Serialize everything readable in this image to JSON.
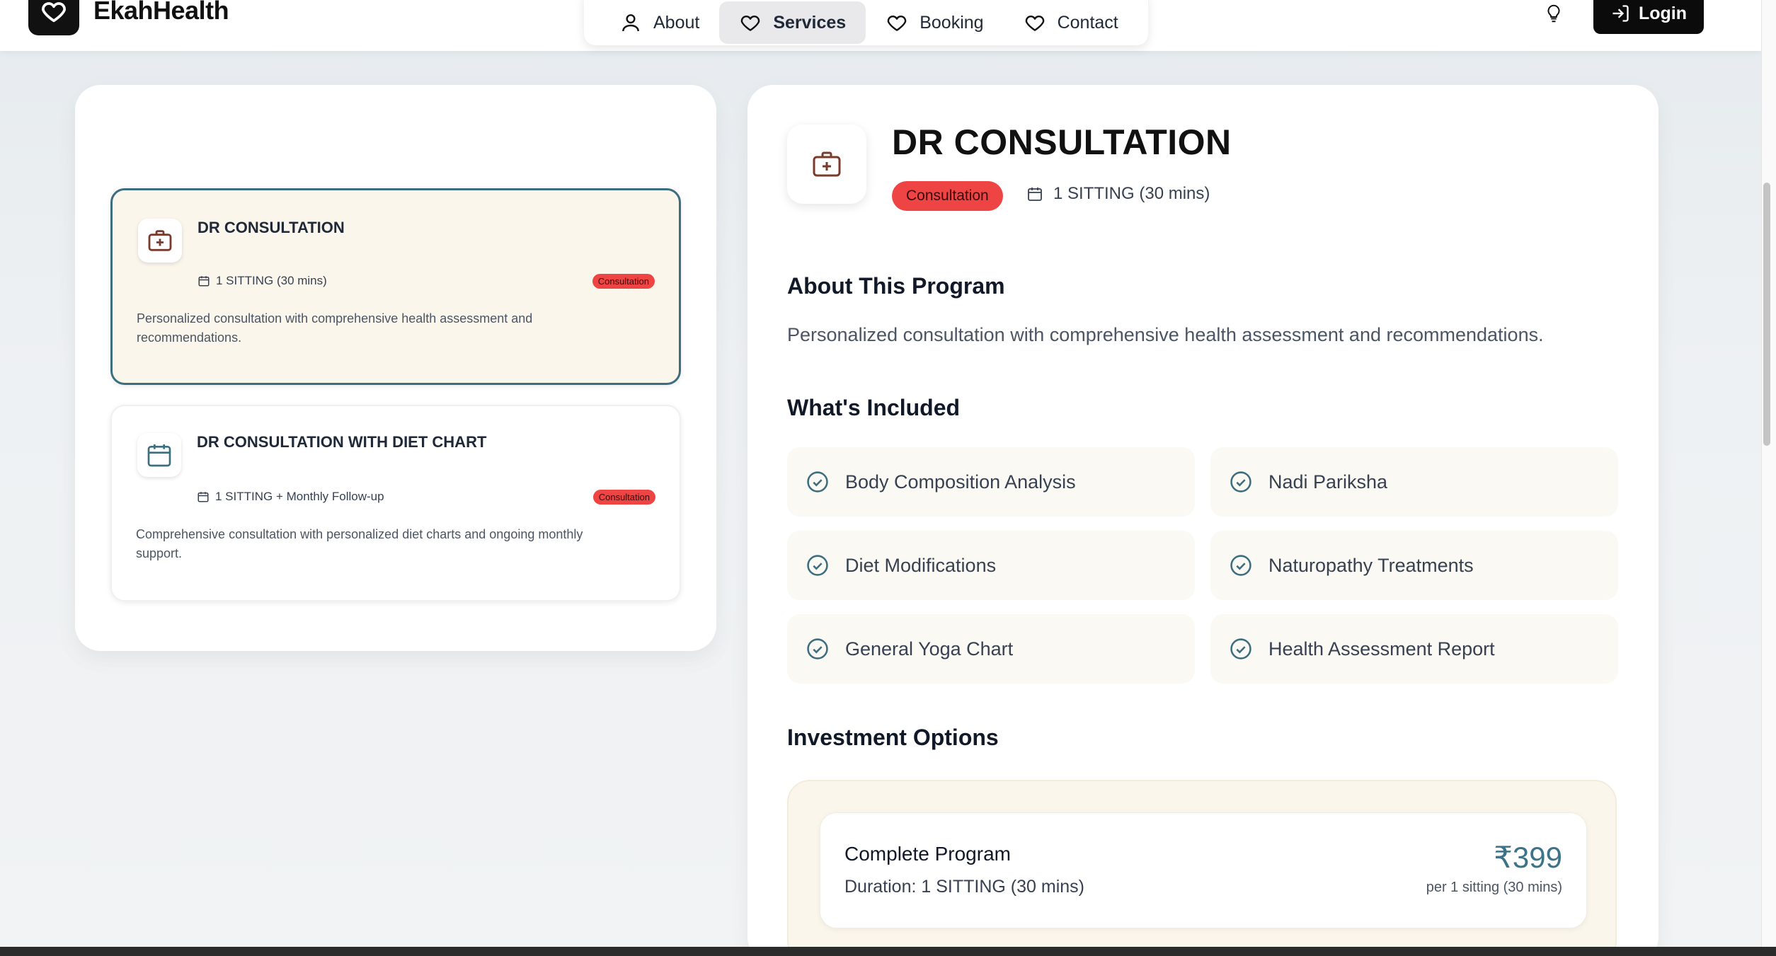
{
  "header": {
    "brand": "EkahHealth",
    "nav": [
      {
        "label": "About",
        "icon": "user-icon"
      },
      {
        "label": "Services",
        "icon": "heart-icon",
        "active": true
      },
      {
        "label": "Booking",
        "icon": "heart-icon"
      },
      {
        "label": "Contact",
        "icon": "heart-icon"
      }
    ],
    "login_label": "Login"
  },
  "services": [
    {
      "title": "DR CONSULTATION",
      "meta": "1 SITTING (30 mins)",
      "badge": "Consultation",
      "description": "Personalized consultation with comprehensive health assessment and recommendations.",
      "icon": "medical-kit-icon",
      "selected": true
    },
    {
      "title": "DR CONSULTATION WITH DIET CHART",
      "meta": "1 SITTING + Monthly Follow-up",
      "badge": "Consultation",
      "description": "Comprehensive consultation with personalized diet charts and ongoing monthly support.",
      "icon": "calendar-icon",
      "selected": false
    }
  ],
  "detail": {
    "title": "DR CONSULTATION",
    "badge": "Consultation",
    "meta": "1 SITTING (30 mins)",
    "about_heading": "About This Program",
    "about_text": "Personalized consultation with comprehensive health assessment and recommendations.",
    "included_heading": "What's Included",
    "included": [
      "Body Composition Analysis",
      "Nadi Pariksha",
      "Diet Modifications",
      "Naturopathy Treatments",
      "General Yoga Chart",
      "Health Assessment Report"
    ],
    "investment_heading": "Investment Options",
    "investment": {
      "name": "Complete Program",
      "duration": "Duration: 1 SITTING (30 mins)",
      "price": "₹399",
      "per": "per 1 sitting (30 mins)"
    }
  },
  "colors": {
    "accent": "#3d6e80",
    "badge": "#ef4444",
    "selected_bg": "#fbf6ec",
    "price": "#3d7389"
  }
}
